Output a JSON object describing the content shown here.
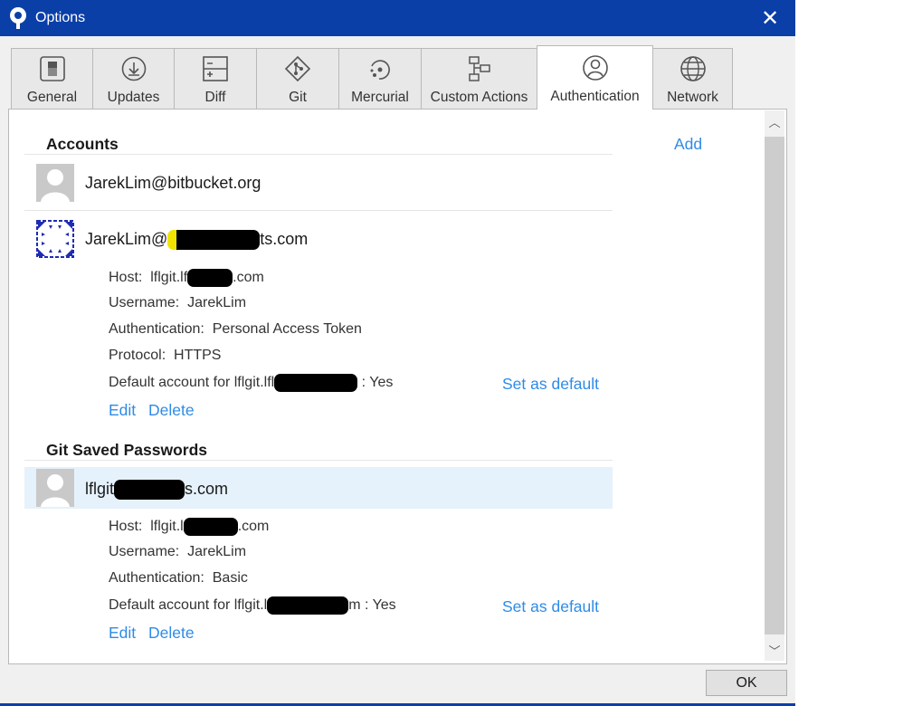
{
  "window": {
    "title": "Options",
    "close_glyph": "✕"
  },
  "tabs": [
    {
      "label": "General",
      "icon": "general-icon"
    },
    {
      "label": "Updates",
      "icon": "download-icon"
    },
    {
      "label": "Diff",
      "icon": "diff-icon"
    },
    {
      "label": "Git",
      "icon": "git-icon"
    },
    {
      "label": "Mercurial",
      "icon": "mercurial-icon"
    },
    {
      "label": "Custom Actions",
      "icon": "custom-actions-icon"
    },
    {
      "label": "Authentication",
      "icon": "user-icon",
      "active": true
    },
    {
      "label": "Network",
      "icon": "globe-icon"
    }
  ],
  "accounts": {
    "heading": "Accounts",
    "add_label": "Add",
    "items": [
      {
        "name": "JarekLim@bitbucket.org"
      },
      {
        "name_prefix": "JarekLim@",
        "name_suffix": "ts.com",
        "host_label": "Host:",
        "host_prefix": "lflgit.lf",
        "host_suffix": ".com",
        "username_label": "Username:",
        "username": "JarekLim",
        "auth_label": "Authentication:",
        "auth": "Personal Access Token",
        "protocol_label": "Protocol:",
        "protocol": "HTTPS",
        "default_label": "Default account for lflgit.lfl",
        "default_value": ":  Yes",
        "set_default": "Set as default",
        "edit": "Edit",
        "delete": "Delete"
      }
    ]
  },
  "saved_passwords": {
    "heading": "Git Saved Passwords",
    "item": {
      "name_prefix": "lflgit",
      "name_suffix": "s.com",
      "host_label": "Host:",
      "host_prefix": "lflgit.l",
      "host_suffix": ".com",
      "username_label": "Username:",
      "username": "JarekLim",
      "auth_label": "Authentication:",
      "auth": "Basic",
      "default_label": "Default account for lflgit.l",
      "default_value": "m :  Yes",
      "set_default": "Set as default",
      "edit": "Edit",
      "delete": "Delete"
    }
  },
  "footer": {
    "ok": "OK"
  },
  "colors": {
    "titlebar": "#0b3fa8",
    "link": "#2f8be6",
    "selected_row": "#e5f1fb"
  }
}
